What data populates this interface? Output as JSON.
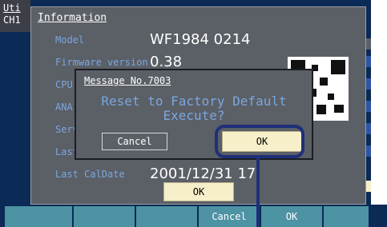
{
  "top_left": {
    "line1": "Uti",
    "line2": "CH1"
  },
  "info": {
    "title": "Information",
    "rows": [
      {
        "label": "Model",
        "value": "WF1984  0214"
      },
      {
        "label": "Firmware version",
        "value": "0.38"
      },
      {
        "label": "CPU"
      },
      {
        "label": "ANA"
      },
      {
        "label": "Serv"
      },
      {
        "label": "Last"
      },
      {
        "label": "Last CalDate",
        "value": "2001/12/31 17:"
      }
    ],
    "ok_label": "OK"
  },
  "modal": {
    "title": "Message No.7003",
    "message_line1": "Reset to Factory Default",
    "message_line2": "Execute?",
    "cancel_label": "Cancel",
    "ok_label": "OK"
  },
  "softkeys": [
    {
      "label": ""
    },
    {
      "label": ""
    },
    {
      "label": ""
    },
    {
      "label": "Cancel"
    },
    {
      "label": "OK"
    },
    {
      "label": ""
    }
  ],
  "colors": {
    "screen_bg": "#0b2a55",
    "panel_bg": "#5b5f66",
    "label_blue": "#7aa7df",
    "ok_button_bg": "#f6efc9",
    "highlight_outline": "#1f2f7a",
    "softkey_bg": "#4d93a3"
  },
  "icons": {
    "qr": "qr-code-icon",
    "arrow": "pointer-arrow-icon"
  }
}
